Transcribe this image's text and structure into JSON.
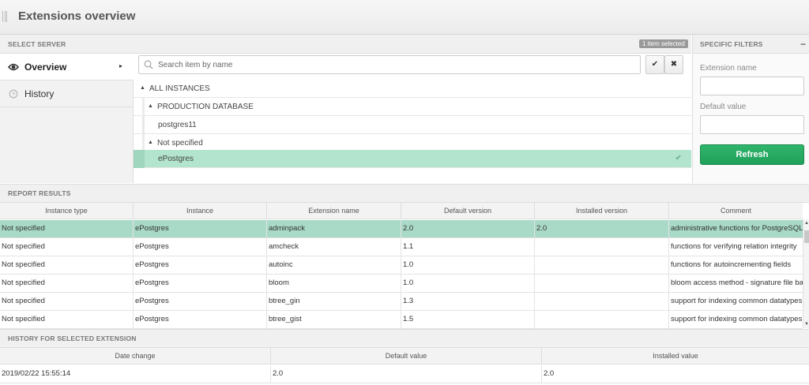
{
  "header": {
    "title": "Extensions overview"
  },
  "select_server": {
    "label": "SELECT SERVER",
    "badge": "1 item selected"
  },
  "filters": {
    "label": "SPECIFIC FILTERS",
    "collapse": "−",
    "extension_name_label": "Extension name",
    "default_value_label": "Default value",
    "extension_name_value": "",
    "default_value_value": "",
    "refresh_label": "Refresh"
  },
  "nav": {
    "items": [
      {
        "label": "Overview",
        "icon": "eye-icon",
        "active": true
      },
      {
        "label": "History",
        "icon": "history-icon",
        "active": false
      }
    ]
  },
  "search": {
    "placeholder": "Search item by name",
    "value": ""
  },
  "tree": {
    "all_instances": "ALL INSTANCES",
    "production": "PRODUCTION DATABASE",
    "postgres11": "postgres11",
    "not_specified": "Not specified",
    "epostgres": "ePostgres"
  },
  "report": {
    "label": "REPORT RESULTS",
    "columns": [
      "Instance type",
      "Instance",
      "Extension name",
      "Default version",
      "Installed version",
      "Comment"
    ],
    "rows": [
      [
        "Not specified",
        "ePostgres",
        "adminpack",
        "2.0",
        "2.0",
        "administrative functions for PostgreSQL"
      ],
      [
        "Not specified",
        "ePostgres",
        "amcheck",
        "1.1",
        "",
        "functions for verifying relation integrity"
      ],
      [
        "Not specified",
        "ePostgres",
        "autoinc",
        "1.0",
        "",
        "functions for autoincrementing fields"
      ],
      [
        "Not specified",
        "ePostgres",
        "bloom",
        "1.0",
        "",
        "bloom access method - signature file based index"
      ],
      [
        "Not specified",
        "ePostgres",
        "btree_gin",
        "1.3",
        "",
        "support for indexing common datatypes in GIN"
      ],
      [
        "Not specified",
        "ePostgres",
        "btree_gist",
        "1.5",
        "",
        "support for indexing common datatypes in GiST"
      ]
    ]
  },
  "history": {
    "label": "HISTORY FOR SELECTED EXTENSION",
    "columns": [
      "Date change",
      "Default value",
      "Installed value"
    ],
    "rows": [
      [
        "2019/02/22 15:55:14",
        "2.0",
        "2.0"
      ]
    ]
  },
  "colors": {
    "accent": "#21a05b",
    "selected_row": "#a9d9c7",
    "selected_tree": "#b3e4cd"
  }
}
